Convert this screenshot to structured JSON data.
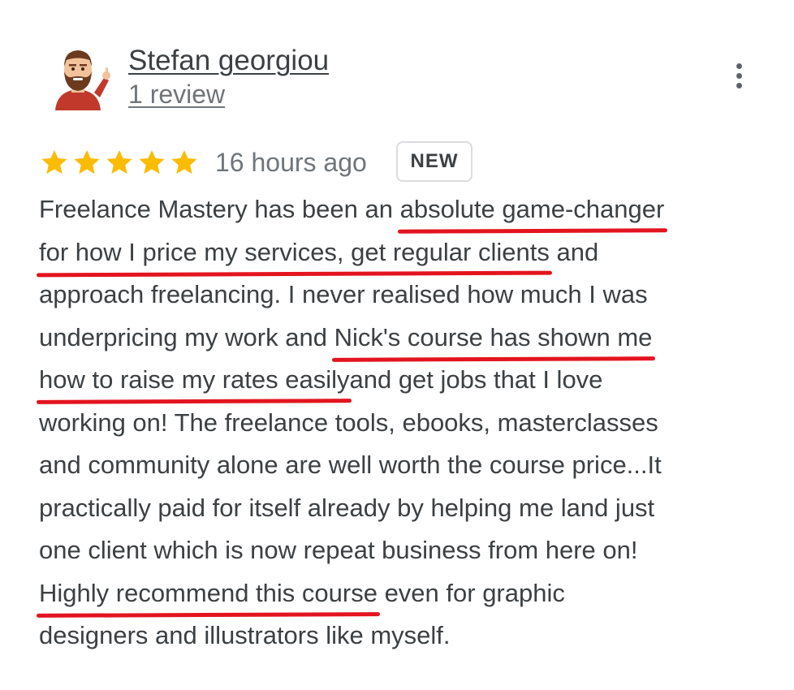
{
  "reviewer": {
    "name": "Stefan georgiou",
    "review_count": "1 review",
    "avatar_icon": "bearded-man-waving-avatar"
  },
  "menu": {
    "icon": "more-vert-icon"
  },
  "rating": {
    "stars": 5,
    "max": 5,
    "star_color": "#fbbc04"
  },
  "time_ago": "16 hours ago",
  "badge": "NEW",
  "highlight_color": "#e3141f",
  "review_lines": [
    [
      "Freelance Mastery has been an ",
      "absolute game-changer"
    ],
    [
      "for how I price my services, get regular clients",
      " and"
    ],
    [
      "approach freelancing. I never realised how much I was"
    ],
    [
      "underpricing my work and ",
      "Nick's course has shown me"
    ],
    [
      "how to raise my rates easily",
      "and get jobs that I love"
    ],
    [
      "working on! The freelance tools, ebooks, masterclasses"
    ],
    [
      "and community alone are well worth the course price...It"
    ],
    [
      "practically paid for itself already by helping me land just"
    ],
    [
      "one client which is now repeat business from here on!"
    ],
    [
      "Highly recommend this course",
      " even for graphic"
    ],
    [
      "designers and illustrators like myself."
    ]
  ]
}
